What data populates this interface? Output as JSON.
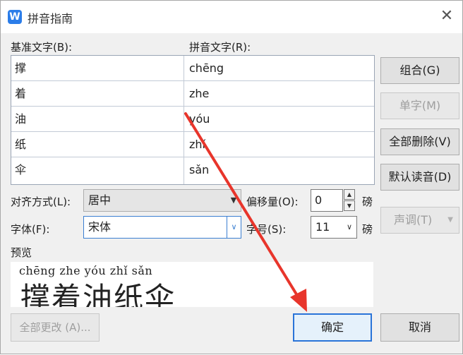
{
  "window": {
    "title": "拼音指南",
    "app_icon_letter": "W",
    "close_glyph": "✕"
  },
  "table": {
    "col_base": "基准文字(B):",
    "col_pinyin": "拼音文字(R):",
    "rows": [
      {
        "base": "撑",
        "pinyin": "chēng"
      },
      {
        "base": "着",
        "pinyin": "zhe"
      },
      {
        "base": "油",
        "pinyin": "yóu"
      },
      {
        "base": "纸",
        "pinyin": "zhǐ"
      },
      {
        "base": "伞",
        "pinyin": "sǎn"
      }
    ]
  },
  "side_buttons": {
    "combine": "组合(G)",
    "single": "单字(M)",
    "delete_all": "全部删除(V)",
    "default_reading": "默认读音(D)",
    "tone": "声调(T)"
  },
  "options": {
    "align_label": "对齐方式(L):",
    "align_value": "居中",
    "offset_label": "偏移量(O):",
    "offset_value": "0",
    "offset_unit": "磅",
    "font_label": "字体(F):",
    "font_value": "宋体",
    "size_label": "字号(S):",
    "size_value": "11",
    "size_unit": "磅"
  },
  "preview": {
    "label": "预览",
    "pinyin_line": "chēng zhe  yóu  zhǐ  sǎn",
    "chars_line": "撑着油纸伞"
  },
  "bottom_buttons": {
    "apply_all": "全部更改 (A)...",
    "ok": "确定",
    "cancel": "取消"
  },
  "colors": {
    "accent": "#2a74d8",
    "annotation_arrow": "#e8352b"
  }
}
